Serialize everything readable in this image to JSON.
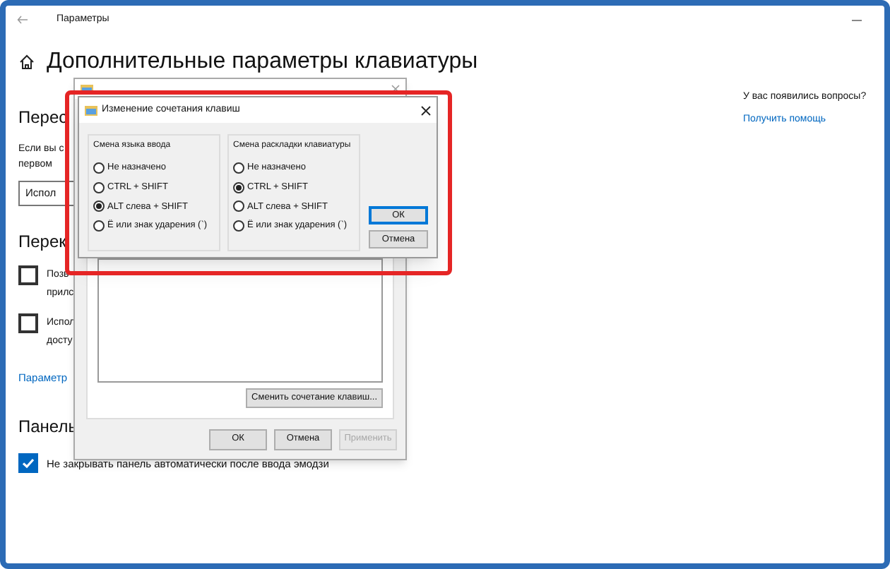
{
  "window": {
    "title": "Параметры"
  },
  "page": {
    "title": "Дополнительные параметры клавиатуры"
  },
  "section_1": {
    "heading": "Перес",
    "description_lines": [
      "Если вы с",
      "первом"
    ],
    "dropdown": {
      "value": "Испол"
    }
  },
  "section_2": {
    "heading": "Перек",
    "options": [
      {
        "lines": [
          "Позв",
          "прилс"
        ],
        "checked": false
      },
      {
        "lines": [
          "Испол",
          "досту"
        ],
        "checked": false
      }
    ],
    "link": "Параметр"
  },
  "section_3": {
    "heading": "Панель",
    "options": [
      {
        "label": "Не закрывать панель автоматически после ввода эмодзи",
        "checked": true
      }
    ]
  },
  "help": {
    "question": "У вас появились вопросы?",
    "link": "Получить помощь"
  },
  "languages_dialog": {
    "change_button": "Сменить сочетание клавиш...",
    "buttons": [
      {
        "label": "ОК",
        "disabled": false
      },
      {
        "label": "Отмена",
        "disabled": false
      },
      {
        "label": "Применить",
        "disabled": true
      }
    ]
  },
  "hotkey_dialog": {
    "title": "Изменение сочетания клавиш",
    "groups": [
      {
        "title": "Смена языка ввода",
        "options": [
          {
            "label": "Не назначено",
            "selected": false
          },
          {
            "label": "CTRL + SHIFT",
            "selected": false
          },
          {
            "label": "ALT слева + SHIFT",
            "selected": true
          },
          {
            "label": "Ё или знак ударения (`)",
            "selected": false
          }
        ]
      },
      {
        "title": "Смена раскладки клавиатуры",
        "options": [
          {
            "label": "Не назначено",
            "selected": false
          },
          {
            "label": "CTRL + SHIFT",
            "selected": true
          },
          {
            "label": "ALT слева + SHIFT",
            "selected": false
          },
          {
            "label": "Ё или знак ударения (`)",
            "selected": false
          }
        ]
      }
    ],
    "buttons": [
      {
        "label": "ОК",
        "default": true
      },
      {
        "label": "Отмена",
        "default": false
      }
    ]
  }
}
